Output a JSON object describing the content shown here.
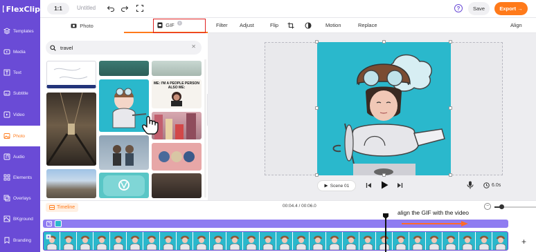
{
  "app": {
    "brand": "FlexClip",
    "title": "Untitled",
    "ratio": "1:1"
  },
  "header": {
    "save_label": "Save",
    "export_label": "Export →"
  },
  "sidebar": {
    "items": [
      {
        "label": "Templates",
        "icon": "layers-icon"
      },
      {
        "label": "Media",
        "icon": "media-folder-icon"
      },
      {
        "label": "Text",
        "icon": "text-icon"
      },
      {
        "label": "Subtitle",
        "icon": "subtitle-icon"
      },
      {
        "label": "Video",
        "icon": "video-icon"
      },
      {
        "label": "Photo",
        "icon": "photo-icon",
        "active": true
      },
      {
        "label": "Audio",
        "icon": "audio-icon"
      },
      {
        "label": "Elements",
        "icon": "elements-icon"
      },
      {
        "label": "Overlays",
        "icon": "overlays-icon"
      },
      {
        "label": "BKground",
        "icon": "background-icon"
      },
      {
        "label": "Branding",
        "icon": "branding-icon"
      }
    ]
  },
  "panel": {
    "tabs": [
      {
        "label": "Photo"
      },
      {
        "label": "GIF",
        "active": true
      }
    ],
    "search": {
      "value": "travel"
    },
    "meme_text": "ME: I'M A PEOPLE PERSON ALSO ME:"
  },
  "toolbar": {
    "items": [
      "Filter",
      "Adjust",
      "Flip",
      "Motion",
      "Replace",
      "Align"
    ]
  },
  "player": {
    "scene_label": "Scene 01",
    "duration": "6.0s"
  },
  "timeline": {
    "label": "Timeline",
    "time": "00:04.4 / 00:06.0",
    "annotation": "align the GIF with the video"
  },
  "colors": {
    "brand": "#6a4bd6",
    "accent": "#ff7a1a",
    "gif_bg": "#2ab8cc"
  }
}
